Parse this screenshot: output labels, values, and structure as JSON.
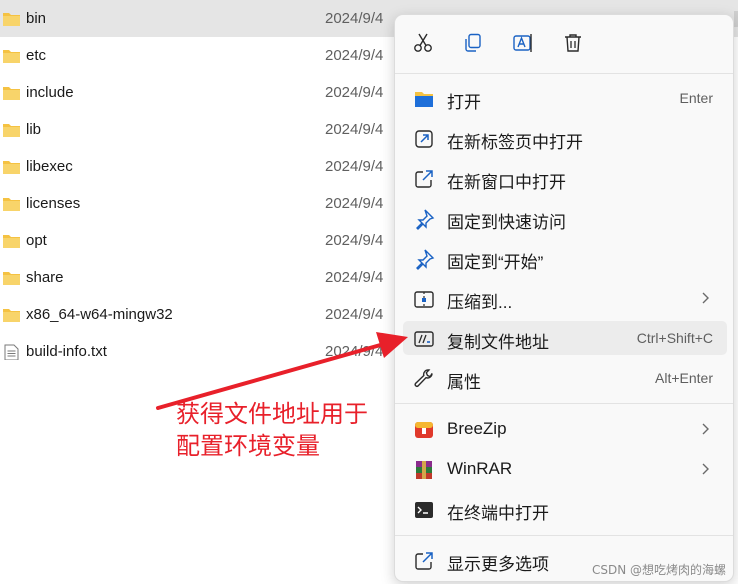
{
  "files": [
    {
      "name": "bin",
      "date": "2024/9/4",
      "type": "folder",
      "selected": true
    },
    {
      "name": "etc",
      "date": "2024/9/4",
      "type": "folder"
    },
    {
      "name": "include",
      "date": "2024/9/4",
      "type": "folder"
    },
    {
      "name": "lib",
      "date": "2024/9/4",
      "type": "folder"
    },
    {
      "name": "libexec",
      "date": "2024/9/4",
      "type": "folder"
    },
    {
      "name": "licenses",
      "date": "2024/9/4",
      "type": "folder"
    },
    {
      "name": "opt",
      "date": "2024/9/4",
      "type": "folder"
    },
    {
      "name": "share",
      "date": "2024/9/4",
      "type": "folder"
    },
    {
      "name": "x86_64-w64-mingw32",
      "date": "2024/9/4",
      "type": "folder"
    },
    {
      "name": "build-info.txt",
      "date": "2024/9/4",
      "type": "file"
    }
  ],
  "context_menu": {
    "quick_actions": [
      "cut-icon",
      "copy-icon",
      "rename-icon",
      "delete-icon"
    ],
    "items": [
      {
        "icon": "open-folder-icon",
        "label": "打开",
        "shortcut": "Enter"
      },
      {
        "icon": "new-tab-icon",
        "label": "在新标签页中打开",
        "shortcut": ""
      },
      {
        "icon": "new-window-icon",
        "label": "在新窗口中打开",
        "shortcut": ""
      },
      {
        "icon": "pin-icon",
        "label": "固定到快速访问",
        "shortcut": ""
      },
      {
        "icon": "pin-start-icon",
        "label": "固定到“开始”",
        "shortcut": ""
      },
      {
        "icon": "compress-icon",
        "label": "压缩到...",
        "shortcut": "",
        "submenu": true
      },
      {
        "icon": "copy-path-icon",
        "label": "复制文件地址",
        "shortcut": "Ctrl+Shift+C",
        "hover": true
      },
      {
        "icon": "properties-icon",
        "label": "属性",
        "shortcut": "Alt+Enter"
      },
      {
        "icon": "breezip-icon",
        "label": "BreeZip",
        "shortcut": "",
        "submenu": true
      },
      {
        "icon": "winrar-icon",
        "label": "WinRAR",
        "shortcut": "",
        "submenu": true
      },
      {
        "icon": "terminal-icon",
        "label": "在终端中打开",
        "shortcut": ""
      },
      {
        "icon": "more-options-icon",
        "label": "显示更多选项",
        "shortcut": ""
      }
    ]
  },
  "annotation": {
    "line1": "获得文件地址用于",
    "line2": "配置环境变量",
    "color": "#e8202a"
  },
  "watermark": "CSDN @想吃烤肉的海螺",
  "colors": {
    "folder": "#f5c242",
    "selected_row": "#e5e5e5",
    "menu_bg": "#f9f9f9"
  }
}
